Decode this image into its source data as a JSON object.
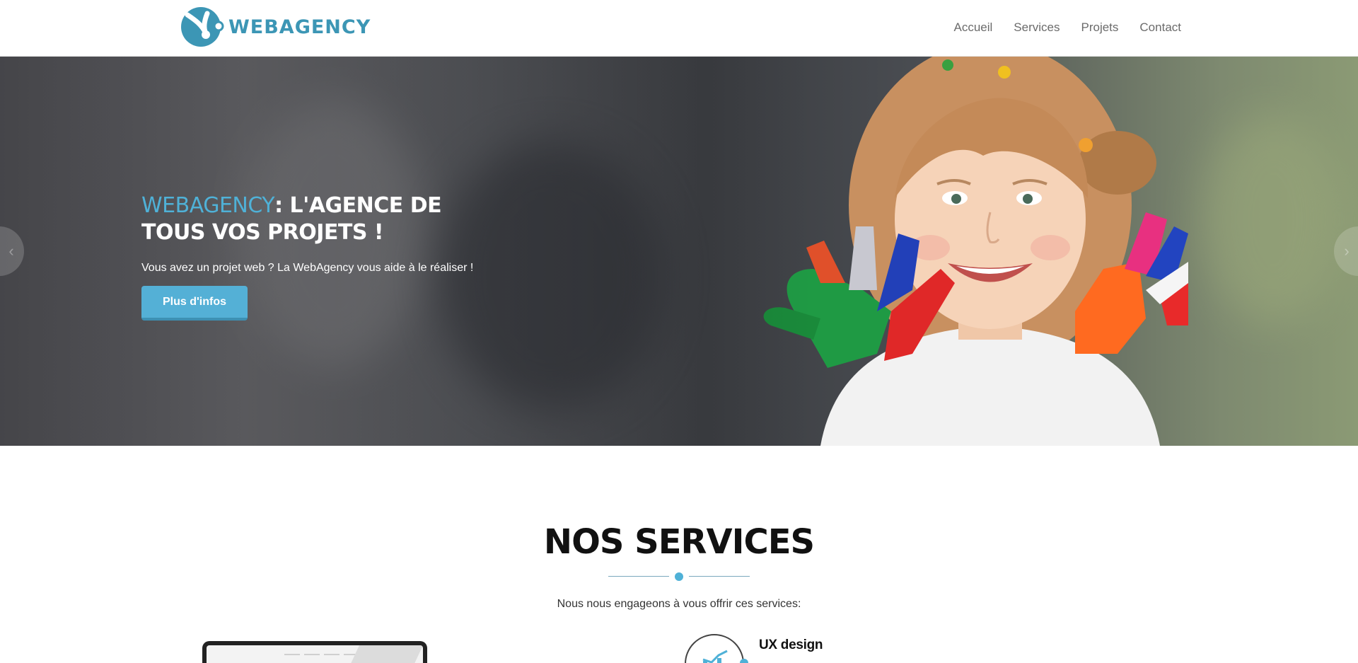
{
  "header": {
    "logo_text": "WEBAGENCY",
    "nav": [
      {
        "label": "Accueil"
      },
      {
        "label": "Services"
      },
      {
        "label": "Projets"
      },
      {
        "label": "Contact"
      }
    ]
  },
  "hero": {
    "title_accent": "WEBAGENCY",
    "title_rest": ": L'AGENCE DE TOUS VOS PROJETS !",
    "subtitle": "Vous avez un projet web ? La WebAgency vous aide à le réaliser !",
    "button_label": "Plus d'infos",
    "prev_arrow": "‹",
    "next_arrow": "›"
  },
  "services": {
    "title": "NOS SERVICES",
    "subtitle": "Nous nous engageons à vous offrir ces services:",
    "items": [
      {
        "title": "UX design",
        "icon": "chart-icon"
      }
    ]
  },
  "colors": {
    "brand": "#3c96b5",
    "accent": "#4fb1d7",
    "button": "#54b0d6"
  }
}
